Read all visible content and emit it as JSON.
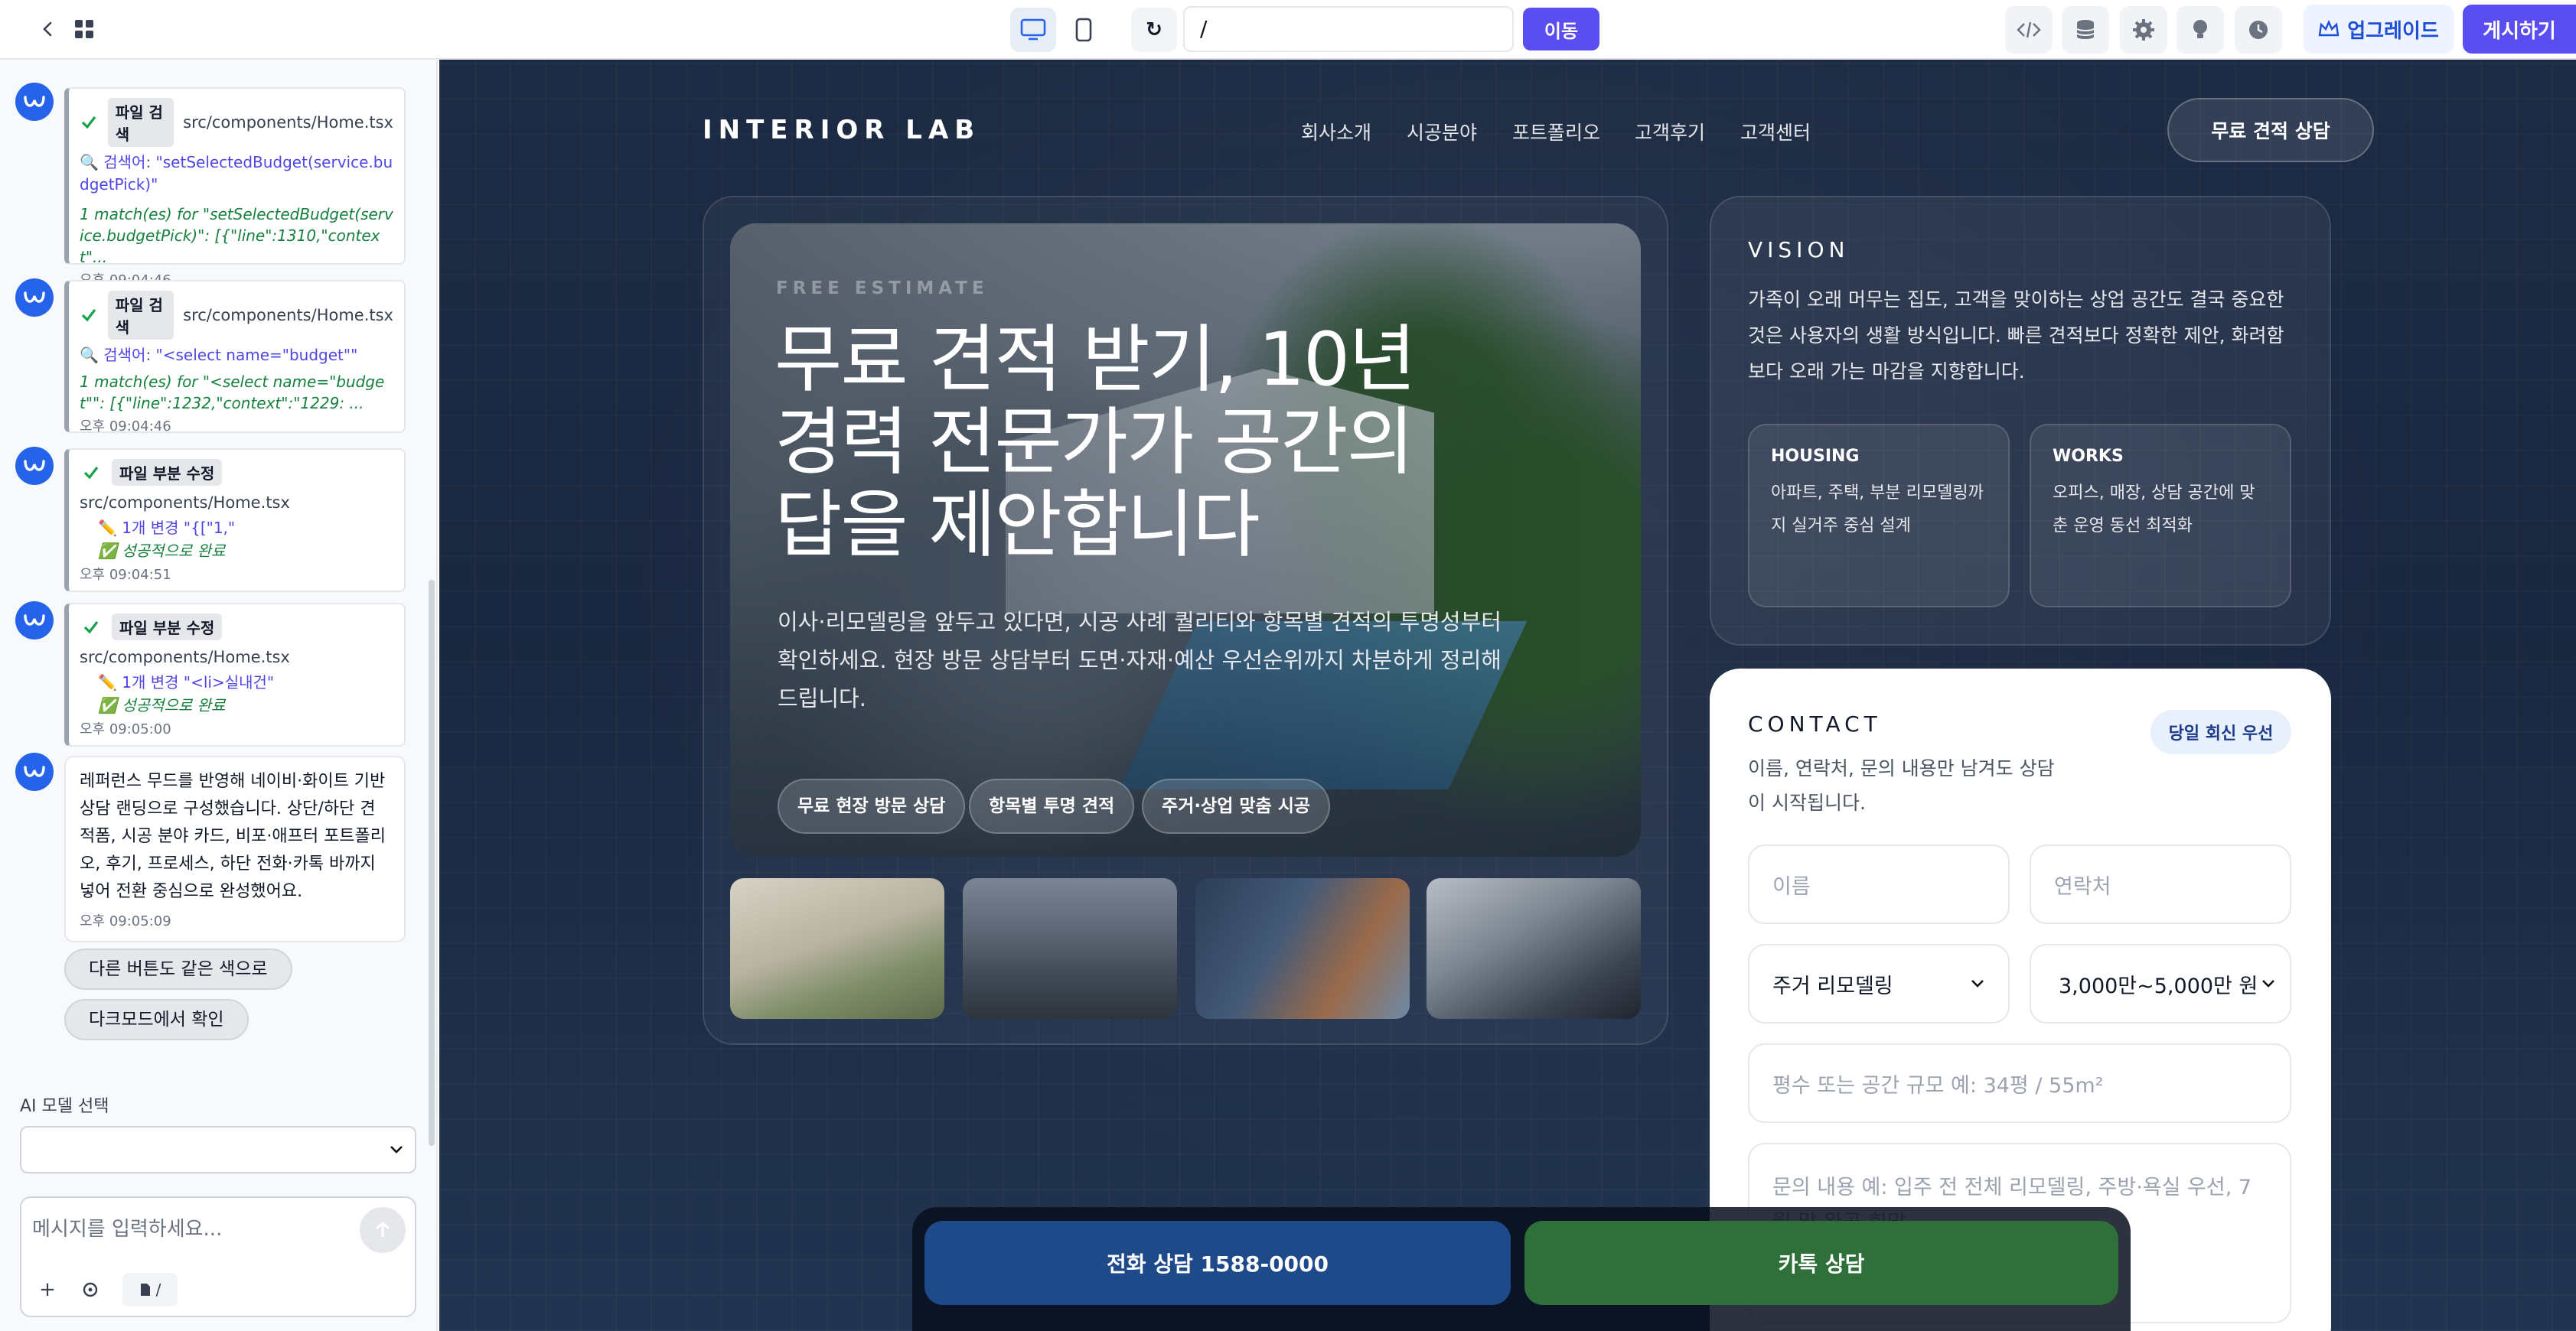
{
  "topbar": {
    "url": "/",
    "go_label": "이동",
    "upgrade_label": "업그레이드",
    "publish_label": "게시하기"
  },
  "chat": {
    "messages": [
      {
        "tag": "파일 검색",
        "path": "src/components/Home.tsx",
        "query": "🔍 검색어: \"setSelectedBudget(service.budgetPick)\"",
        "result": "1 match(es) for \"setSelectedBudget(service.budgetPick)\": [{\"line\":1310,\"context\"...",
        "time": "오후 09:04:46"
      },
      {
        "tag": "파일 검색",
        "path": "src/components/Home.tsx",
        "query": "🔍 검색어: \"<select name=\"budget\"\"",
        "result": "1 match(es) for \"<select name=\"budget\"\": [{\"line\":1232,\"context\":\"1229: ...",
        "time": "오후 09:04:46"
      },
      {
        "tag": "파일 부분 수정",
        "path": "src/components/Home.tsx",
        "change": "✏️ 1개 변경 \"{[\"1,\"",
        "status": "✅ 성공적으로 완료",
        "time": "오후 09:04:51"
      },
      {
        "tag": "파일 부분 수정",
        "path": "src/components/Home.tsx",
        "change": "✏️ 1개 변경 \"<li>실내건\"",
        "status": "✅ 성공적으로 완료",
        "time": "오후 09:05:00"
      }
    ],
    "summary": {
      "text": "레퍼런스 무드를 반영해 네이비·화이트 기반 상담 랜딩으로 구성했습니다. 상단/하단 견적폼, 시공 분야 카드, 비포·애프터 포트폴리오, 후기, 프로세스, 하단 전화·카톡 바까지 넣어 전환 중심으로 완성했어요.",
      "time": "오후 09:05:09"
    },
    "suggestions": [
      "다른 버튼도 같은 색으로",
      "다크모드에서 확인"
    ],
    "model_label": "AI 모델 선택",
    "input_placeholder": "메시지를 입력하세요...",
    "path_chip": "/"
  },
  "site": {
    "brand": "INTERIOR LAB",
    "nav": [
      "회사소개",
      "시공분야",
      "포트폴리오",
      "고객후기",
      "고객센터"
    ],
    "nav_cta": "무료 견적 상담",
    "hero": {
      "eyebrow": "FREE ESTIMATE",
      "title": "무료 견적 받기, 10년 경력 전문가가 공간의 답을 제안합니다",
      "text": "이사·리모델링을 앞두고 있다면, 시공 사례 퀄리티와 항목별 견적의 투명성부터 확인하세요. 현장 방문 상담부터 도면·자재·예산 우선순위까지 차분하게 정리해드립니다.",
      "pills": [
        "무료 현장 방문 상담",
        "항목별 투명 견적",
        "주거·상업 맞춤 시공"
      ]
    },
    "vision": {
      "title": "VISION",
      "text": "가족이 오래 머무는 집도, 고객을 맞이하는 상업 공간도 결국 중요한 것은 사용자의 생활 방식입니다. 빠른 견적보다 정확한 제안, 화려함보다 오래 가는 마감을 지향합니다.",
      "cards": [
        {
          "title": "HOUSING",
          "text": "아파트, 주택, 부분 리모델링까지 실거주 중심 설계"
        },
        {
          "title": "WORKS",
          "text": "오피스, 매장, 상담 공간에 맞춘 운영 동선 최적화"
        }
      ]
    },
    "contact": {
      "title": "CONTACT",
      "badge": "당일 회신 우선",
      "text": "이름, 연락처, 문의 내용만 남겨도 상담이 시작됩니다.",
      "name_placeholder": "이름",
      "phone_placeholder": "연락처",
      "type_value": "주거 리모델링",
      "budget_value": "3,000만~5,000만 원",
      "size_placeholder": "평수 또는 공간 규모 예: 34평 / 55m²",
      "message_placeholder": "문의 내용 예: 입주 전 전체 리모델링, 주방·욕실 우선, 7월 말 완공 희망"
    },
    "bottom": {
      "phone_label": "전화 상담 1588-0000",
      "kakao_label": "카톡 상담"
    }
  }
}
